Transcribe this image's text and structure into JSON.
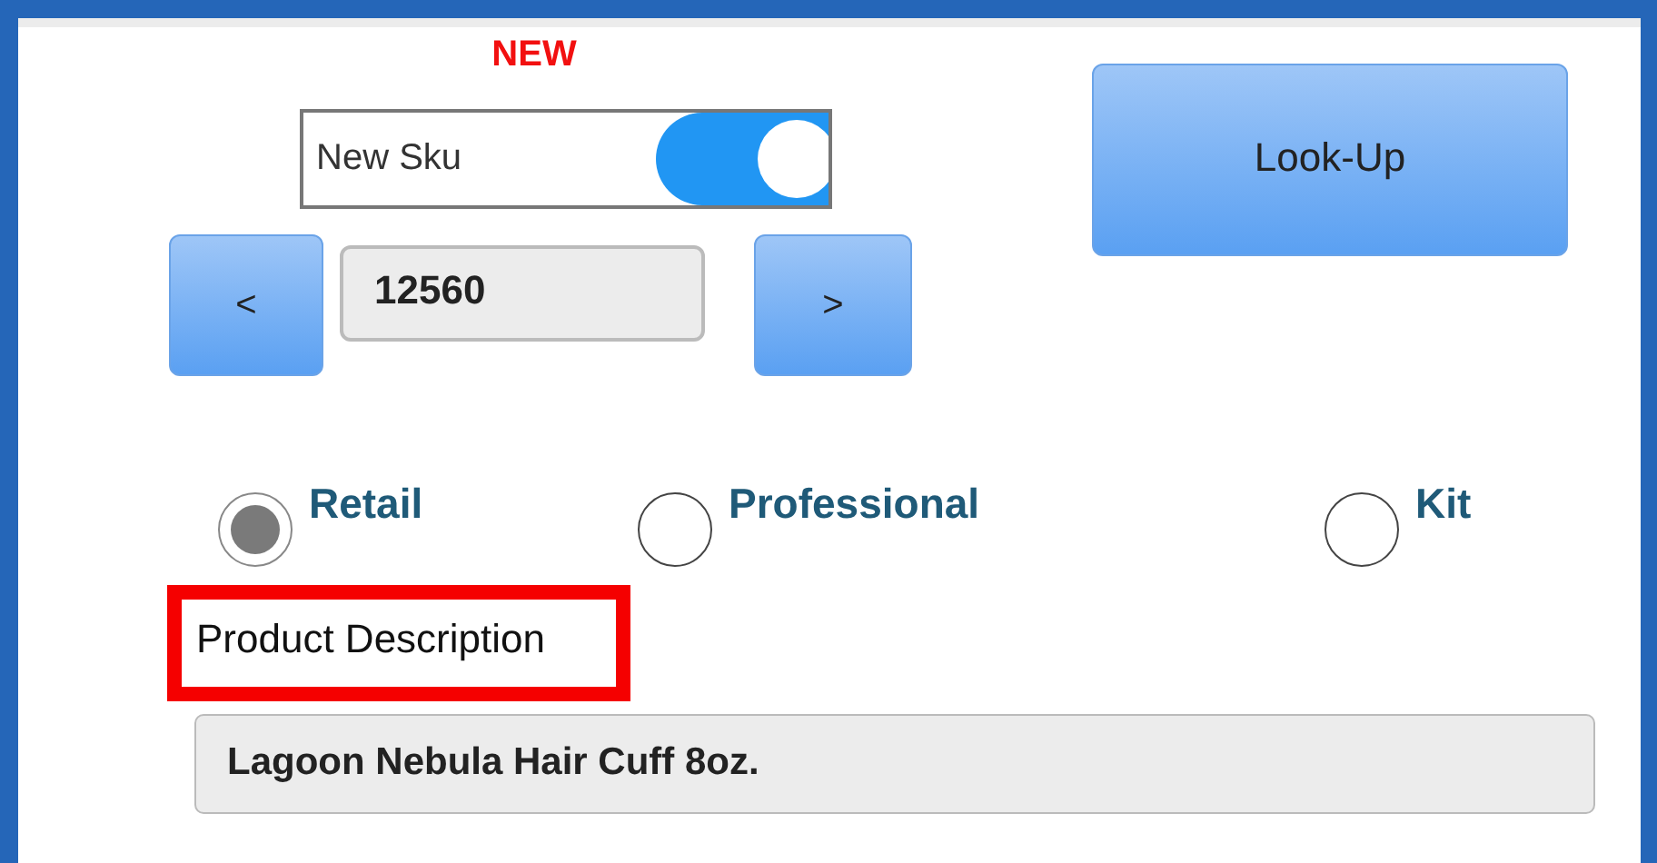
{
  "new_badge": "NEW",
  "new_sku_toggle": {
    "label": "New Sku",
    "on": true
  },
  "sku_nav": {
    "prev": "<",
    "value": "12560",
    "next": ">"
  },
  "lookup_button": "Look-Up",
  "product_type": [
    {
      "label": "Retail",
      "selected": true
    },
    {
      "label": "Professional",
      "selected": false
    },
    {
      "label": "Kit",
      "selected": false
    }
  ],
  "description": {
    "label": "Product Description",
    "value": "Lagoon Nebula Hair Cuff 8oz."
  }
}
